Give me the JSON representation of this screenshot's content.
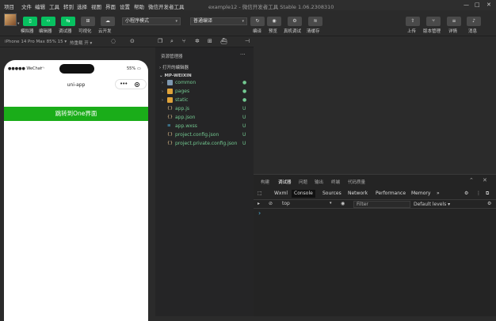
{
  "menu": [
    "项目",
    "文件",
    "编辑",
    "工具",
    "转到",
    "选择",
    "视图",
    "界面",
    "设置",
    "帮助",
    "微信开发者工具"
  ],
  "window_title": "example12 - 微信开发者工具 Stable 1.06.2308310",
  "toolbar": {
    "left_buttons": [
      {
        "label": "模拟器",
        "icon": "phone-icon"
      },
      {
        "label": "编辑器",
        "icon": "code-icon"
      },
      {
        "label": "调试器",
        "icon": "debug-icon"
      },
      {
        "label": "可视化",
        "icon": "visual-icon"
      },
      {
        "label": "云开发",
        "icon": "cloud-icon"
      }
    ],
    "mode_select": "小程序模式",
    "compile_select": "普通编译",
    "mid_buttons": [
      {
        "label": "编译",
        "icon": "refresh-icon"
      },
      {
        "label": "预览",
        "icon": "eye-icon"
      },
      {
        "label": "真机调试",
        "icon": "gear-icon"
      },
      {
        "label": "清缓存",
        "icon": "layers-icon"
      }
    ],
    "right_buttons": [
      {
        "label": "上传",
        "icon": "upload-icon"
      },
      {
        "label": "版本管理",
        "icon": "version-icon"
      },
      {
        "label": "详情",
        "icon": "detail-icon"
      },
      {
        "label": "消息",
        "icon": "bell-icon"
      }
    ]
  },
  "simulator_bar": {
    "device": "iPhone 14 Pro Max 85% 15 ▾",
    "hot_reload": "热重载 开 ▾"
  },
  "phone": {
    "carrier": "●●●●● WeChat",
    "battery": "55%",
    "nav_title": "uni-app",
    "button_label": "跳转到One界面"
  },
  "explorer": {
    "header": "资源管理器",
    "more": "···",
    "open_editors": "打开的编辑器",
    "project": "MP-WEIXIN",
    "items": [
      {
        "name": "common",
        "type": "folder",
        "status": "●"
      },
      {
        "name": "pages",
        "type": "folder",
        "status": "●"
      },
      {
        "name": "static",
        "type": "folder",
        "status": "●"
      },
      {
        "name": "app.js",
        "type": "js",
        "status": "U"
      },
      {
        "name": "app.json",
        "type": "json",
        "status": "U"
      },
      {
        "name": "app.wxss",
        "type": "wxss",
        "status": "U"
      },
      {
        "name": "project.config.json",
        "type": "json",
        "status": "U"
      },
      {
        "name": "project.private.config.json",
        "type": "json",
        "status": "U"
      }
    ]
  },
  "devtools": {
    "top_tabs": [
      "构建",
      "调试器",
      "问题",
      "输出",
      "终端",
      "代码质量"
    ],
    "active_top_tab": 1,
    "console_tabs": [
      "Wxml",
      "Console",
      "Sources",
      "Network",
      "Performance",
      "Memory",
      "»"
    ],
    "active_console_tab": 1,
    "context": "top",
    "filter_placeholder": "Filter",
    "levels": "Default levels ▾",
    "prompt": "›"
  },
  "colors": {
    "accent": "#07c160",
    "page_button": "#1aad19",
    "folder_gray": "#7f98b0",
    "folder_orange": "#e0a33a"
  }
}
